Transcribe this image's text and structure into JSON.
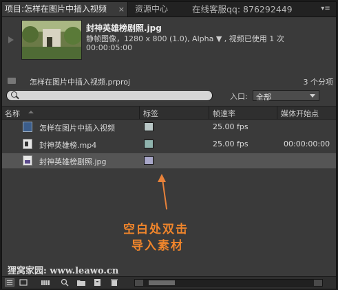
{
  "tabs": {
    "active_label": "项目:怎样在图片中插入视频",
    "close_glyph": "×",
    "resources_label": "资源中心",
    "online_service": "在线客服qq: 876292449",
    "panel_menu_glyph": "▾≡"
  },
  "preview": {
    "file_name": "封神英雄榜剧照.jpg",
    "file_info": "静帧图像，1280 x 800 (1.0), Alpha ▼ , 视频已使用 1 次",
    "duration": "00:00:05:00"
  },
  "project": {
    "file": "怎样在图片中插入视频.prproj",
    "item_count": "3 个分项"
  },
  "search": {
    "placeholder": "",
    "entry_label": "入口:",
    "entry_value": "全部"
  },
  "table": {
    "columns": [
      "名称",
      "标签",
      "帧速率",
      "媒体开始点"
    ],
    "rows": [
      {
        "icon": "sequence-icon",
        "name": "怎样在图片中插入视频",
        "label_color": "#b9c7c6",
        "fps": "25.00 fps",
        "start": ""
      },
      {
        "icon": "video-file-icon",
        "name": "封神英雄榜.mp4",
        "label_color": "#8fb3ad",
        "fps": "25.00 fps",
        "start": "00:00:00:00"
      },
      {
        "icon": "image-file-icon",
        "name": "封神英雄榜剧照.jpg",
        "label_color": "#a8a7c9",
        "fps": "",
        "start": ""
      }
    ]
  },
  "annotation": {
    "line1": "空白处双击",
    "line2": "导入素材"
  },
  "watermark": "狸窝家园: www.leawo.cn",
  "colors": {
    "accent_annotation": "#f0852b",
    "panel_bg": "#3a3a3a",
    "tab_bar_bg": "#222222"
  }
}
